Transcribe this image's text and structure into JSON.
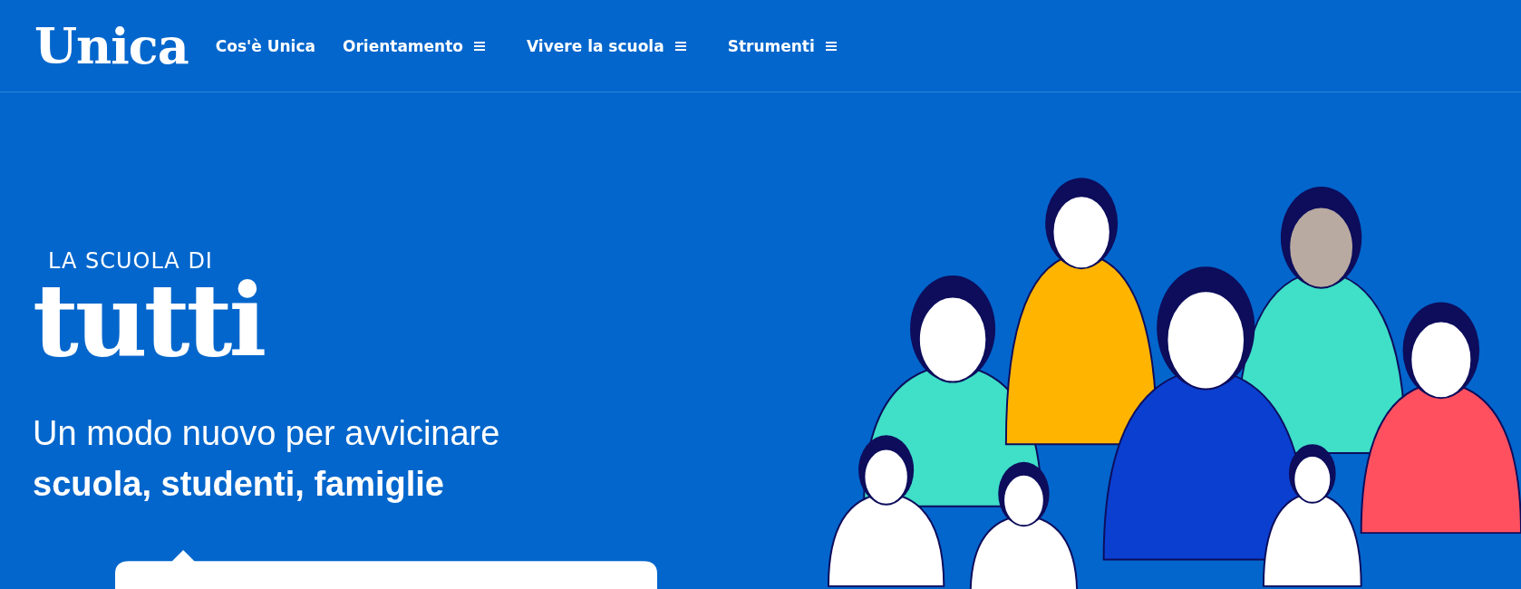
{
  "header": {
    "logo": "Unica",
    "nav": [
      {
        "label": "Cos'è Unica",
        "has_menu": false
      },
      {
        "label": "Orientamento",
        "has_menu": true
      },
      {
        "label": "Vivere la scuola",
        "has_menu": true
      },
      {
        "label": "Strumenti",
        "has_menu": true
      }
    ]
  },
  "hero": {
    "eyebrow": "LA SCUOLA DI",
    "headline": "tutti",
    "subtitle": "Un modo nuovo per avvicinare **scuola, studenti, famiglie**"
  }
}
